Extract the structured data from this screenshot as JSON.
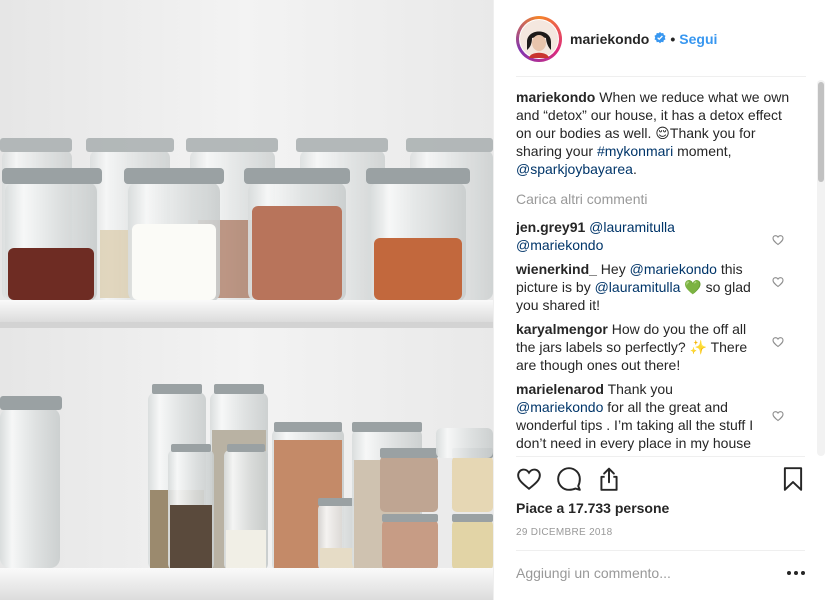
{
  "post": {
    "author": "mariekondo",
    "follow_label": "Segui",
    "separator": "•",
    "caption_user": "mariekondo",
    "caption_part1": " When we reduce what we own and “detox” our house, it has a detox effect on our bodies as well. 😌Thank you for sharing your ",
    "caption_tag": "#mykonmari",
    "caption_part2": " moment, ",
    "caption_mention": "@sparkjoybayarea",
    "caption_end": ".",
    "load_more": "Carica altri commenti",
    "likes": "Piace a 17.733 persone",
    "date": "29 dicembre 2018",
    "add_comment_placeholder": "Aggiungi un commento..."
  },
  "comments": [
    {
      "user": "jen.grey91",
      "parts": [
        " ",
        "@lauramitulla",
        " ",
        "@mariekondo",
        ""
      ]
    },
    {
      "user": "wienerkind_",
      "parts": [
        " Hey ",
        "@mariekondo",
        " this picture is by ",
        "@lauramitulla",
        " 💚 so glad you shared it!"
      ]
    },
    {
      "user": "karyalmengor",
      "parts": [
        " How do you the off all the jars labels so perfectly? ✨ There are though ones out there!",
        "",
        "",
        "",
        ""
      ]
    },
    {
      "user": "marielenarod",
      "parts": [
        " Thank you ",
        "@mariekondo",
        " for all the great and wonderful tips . I’m taking all the stuff I don’t need in every place in my house !",
        "",
        ""
      ]
    }
  ],
  "icons": {
    "heart": "heart-icon",
    "comment": "comment-icon",
    "share": "share-icon",
    "save": "bookmark-icon",
    "verified": "verified-badge-icon",
    "options": "more-options-icon"
  },
  "colors": {
    "link": "#003569",
    "follow": "#3897f0",
    "muted": "#999999",
    "verified": "#3897f0"
  }
}
